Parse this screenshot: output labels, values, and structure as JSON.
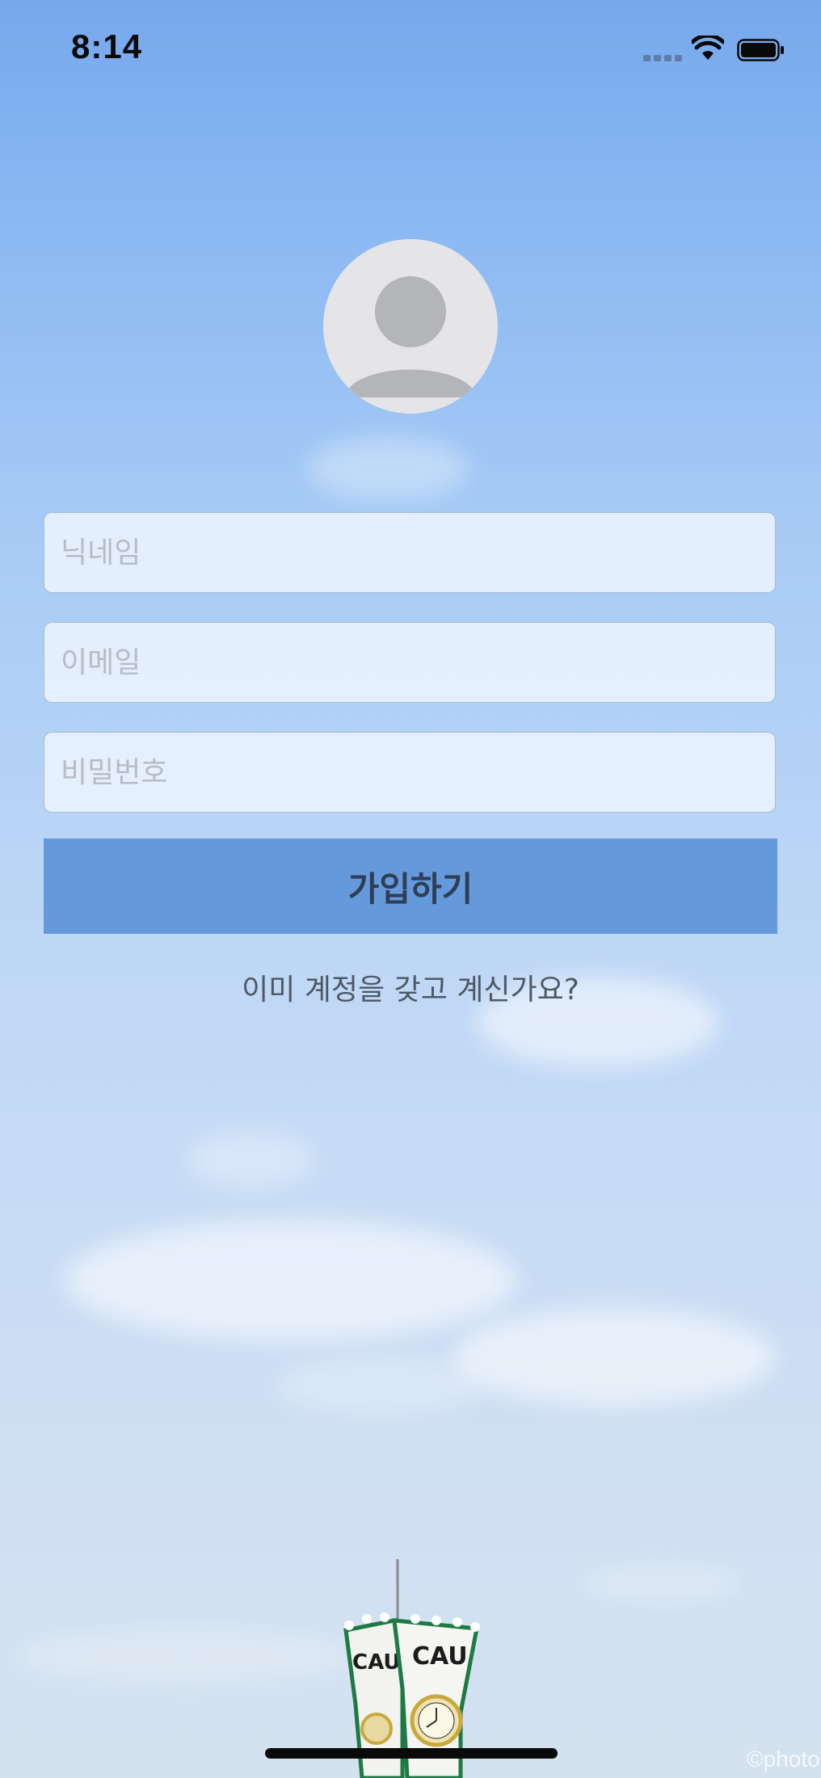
{
  "status_bar": {
    "time": "8:14",
    "icons": [
      "cellular-signal-icon",
      "wifi-icon",
      "battery-icon"
    ]
  },
  "avatar": {
    "icon": "person-placeholder-icon"
  },
  "form": {
    "nickname": {
      "placeholder": "닉네임",
      "value": ""
    },
    "email": {
      "placeholder": "이메일",
      "value": ""
    },
    "password": {
      "placeholder": "비밀번호",
      "value": ""
    },
    "signup_label": "가입하기",
    "login_link_label": "이미 계정을 갖고 계신가요?"
  },
  "background": {
    "tower_sign": "CAU",
    "watermark": "©photo"
  },
  "colors": {
    "button": "#6499dc",
    "button_text": "#2f3d55",
    "field_bg": "#ecf4ff",
    "placeholder": "#b8bcc4"
  }
}
